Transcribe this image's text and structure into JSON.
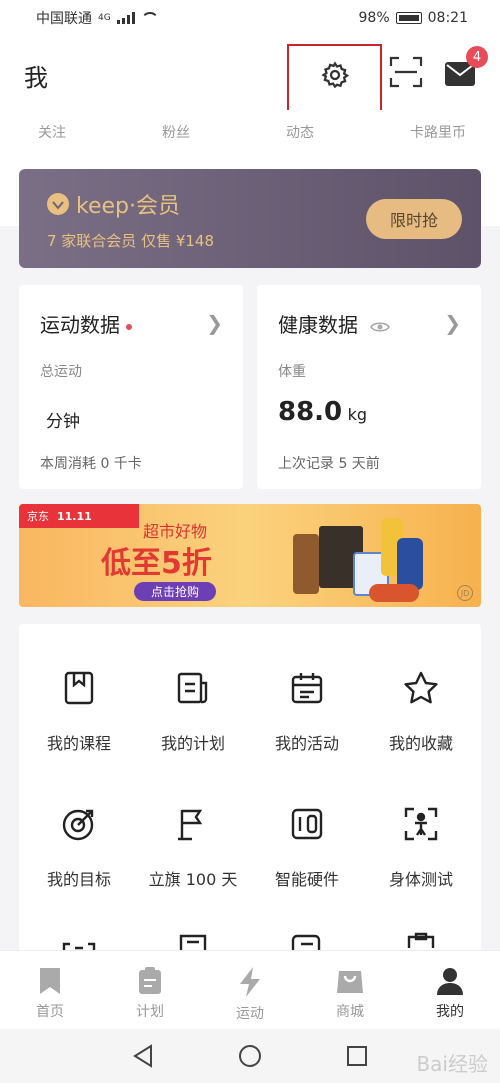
{
  "status_bar": {
    "carrier": "中国联通",
    "network": "4G",
    "battery": "98%",
    "time": "08:21"
  },
  "header": {
    "title": "我",
    "badge_count": "4"
  },
  "stats": [
    "关注",
    "粉丝",
    "动态",
    "卡路里币"
  ],
  "vip": {
    "brand": "keep·会员",
    "subtitle": "7 家联合会员 仅售 ¥148",
    "button": "限时抢",
    "color": "#e8c080"
  },
  "sports_card": {
    "title": "运动数据",
    "label": "总运动",
    "value": "分钟",
    "footer": "本周消耗 0 千卡"
  },
  "health_card": {
    "title": "健康数据",
    "label": "体重",
    "value": "88.0",
    "unit": "kg",
    "footer": "上次记录 5 天前"
  },
  "banner": {
    "shop": "京东",
    "event": "11.11",
    "subtitle": "超市好物",
    "headline": "低至5折",
    "button": "点击抢购",
    "mark": "JD"
  },
  "grid": [
    {
      "label": "我的课程",
      "icon": "bookmark-icon"
    },
    {
      "label": "我的计划",
      "icon": "plan-icon"
    },
    {
      "label": "我的活动",
      "icon": "calendar-icon"
    },
    {
      "label": "我的收藏",
      "icon": "star-icon"
    },
    {
      "label": "我的目标",
      "icon": "target-icon"
    },
    {
      "label": "立旗 100 天",
      "icon": "flag-icon"
    },
    {
      "label": "智能硬件",
      "icon": "device-icon"
    },
    {
      "label": "身体测试",
      "icon": "body-scan-icon"
    }
  ],
  "tabs": [
    {
      "label": "首页",
      "icon": "bookmark-tab-icon"
    },
    {
      "label": "计划",
      "icon": "clipboard-icon"
    },
    {
      "label": "运动",
      "icon": "lightning-icon"
    },
    {
      "label": "商城",
      "icon": "shopping-bag-icon"
    },
    {
      "label": "我的",
      "icon": "user-icon"
    }
  ],
  "watermark": "Bai经验"
}
